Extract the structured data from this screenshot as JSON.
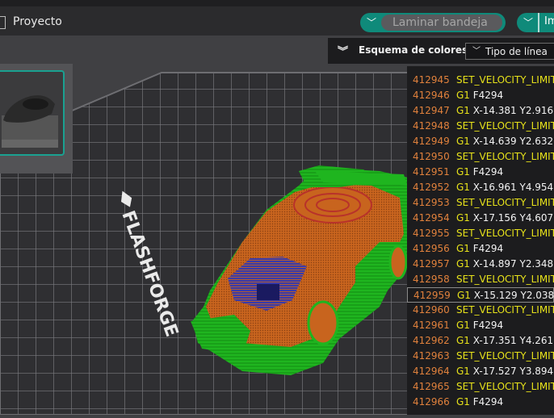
{
  "header": {
    "project_title": "Proyecto",
    "slice_button_label": "Laminar bandeja",
    "right_button_label": "Im"
  },
  "viewport": {
    "brand_logo_text": "FLASHFORGE"
  },
  "color_scheme": {
    "label": "Esquema de colores",
    "selected": "Tipo de línea"
  },
  "gcode_lines": [
    {
      "num": "412945",
      "cmd": "SET_VELOCITY_LIMIT",
      "args": "",
      "yellow": true
    },
    {
      "num": "412946",
      "cmd": "G1",
      "args": "F4294",
      "yellow": false
    },
    {
      "num": "412947",
      "cmd": "G1",
      "args": "X-14.381 Y2.916",
      "yellow": false
    },
    {
      "num": "412948",
      "cmd": "SET_VELOCITY_LIMIT",
      "args": "",
      "yellow": true
    },
    {
      "num": "412949",
      "cmd": "G1",
      "args": "X-14.639 Y2.632",
      "yellow": false
    },
    {
      "num": "412950",
      "cmd": "SET_VELOCITY_LIMIT",
      "args": "",
      "yellow": true
    },
    {
      "num": "412951",
      "cmd": "G1",
      "args": "F4294",
      "yellow": false
    },
    {
      "num": "412952",
      "cmd": "G1",
      "args": "X-16.961 Y4.954",
      "yellow": false
    },
    {
      "num": "412953",
      "cmd": "SET_VELOCITY_LIMIT",
      "args": "",
      "yellow": true
    },
    {
      "num": "412954",
      "cmd": "G1",
      "args": "X-17.156 Y4.607",
      "yellow": false
    },
    {
      "num": "412955",
      "cmd": "SET_VELOCITY_LIMIT",
      "args": "",
      "yellow": true
    },
    {
      "num": "412956",
      "cmd": "G1",
      "args": "F4294",
      "yellow": false
    },
    {
      "num": "412957",
      "cmd": "G1",
      "args": "X-14.897 Y2.348",
      "yellow": false
    },
    {
      "num": "412958",
      "cmd": "SET_VELOCITY_LIMIT",
      "args": "",
      "yellow": true
    },
    {
      "num": "412959",
      "cmd": "G1",
      "args": "X-15.129 Y2.038",
      "yellow": false
    },
    {
      "num": "412960",
      "cmd": "SET_VELOCITY_LIMIT",
      "args": "",
      "yellow": true
    },
    {
      "num": "412961",
      "cmd": "G1",
      "args": "F4294",
      "yellow": false
    },
    {
      "num": "412962",
      "cmd": "G1",
      "args": "X-17.351 Y4.261",
      "yellow": false
    },
    {
      "num": "412963",
      "cmd": "SET_VELOCITY_LIMIT",
      "args": "",
      "yellow": true
    },
    {
      "num": "412964",
      "cmd": "G1",
      "args": "X-17.527 Y3.894",
      "yellow": false
    },
    {
      "num": "412965",
      "cmd": "SET_VELOCITY_LIMIT",
      "args": "",
      "yellow": true
    },
    {
      "num": "412966",
      "cmd": "G1",
      "args": "F4294",
      "yellow": false
    }
  ],
  "active_gcode_line": "412959",
  "colors": {
    "accent": "#0f8a7a",
    "line_number": "#e0813c",
    "velocity_cmd": "#e7e21a",
    "bed": "#303033",
    "model_green": "#1fb51f",
    "model_orange": "#c8641e",
    "model_blue": "#3a3aa8",
    "model_red": "#b8322a"
  }
}
